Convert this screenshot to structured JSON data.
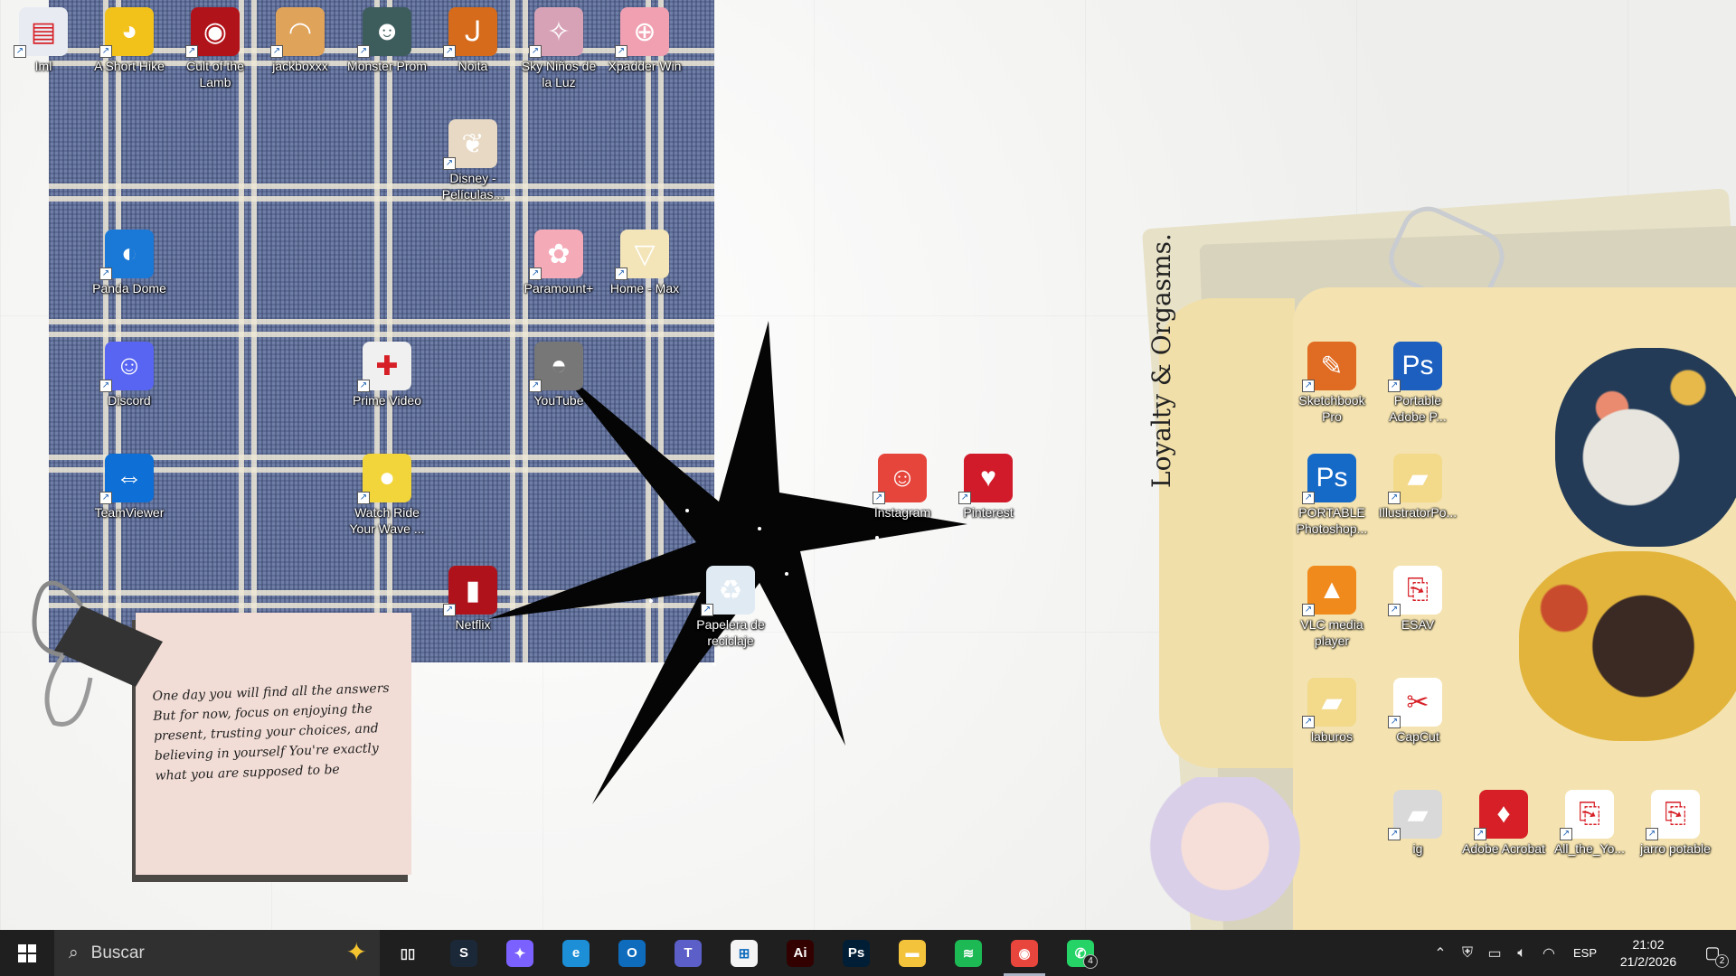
{
  "wallpaper": {
    "folder_title": "Loyalty & Orgasms.",
    "sticky_note": "One day you will find all the answers But for now, focus on enjoying the present, trusting your choices, and believing in yourself You're exactly what you are supposed to be"
  },
  "desktop_icons": [
    {
      "label": "Iml",
      "icon": "app-window-icon",
      "color": "#e8ecf2"
    },
    {
      "label": "A Short Hike",
      "icon": "bird-icon",
      "color": "#f2c21b"
    },
    {
      "label": "Cult of the Lamb",
      "icon": "eye-icon",
      "color": "#b1131a"
    },
    {
      "label": "jackboxxx",
      "icon": "croissant-icon",
      "color": "#e0a35a"
    },
    {
      "label": "Monster Prom",
      "icon": "monster-icon",
      "color": "#3d5c5c"
    },
    {
      "label": "Noita",
      "icon": "noita-icon",
      "color": "#d56b1b"
    },
    {
      "label": "Sky Niños de la Luz",
      "icon": "sky-icon",
      "color": "#d8a2b6"
    },
    {
      "label": "Xpadder Win",
      "icon": "gamepad-icon",
      "color": "#f0a0b0"
    },
    {
      "label": "Disney - Películas...",
      "icon": "cat-figure-icon",
      "color": "#e8d9c4"
    },
    {
      "label": "Panda Dome",
      "icon": "panda-dome-icon",
      "color": "#1a78d6"
    },
    {
      "label": "Paramount+",
      "icon": "paramount-icon",
      "color": "#f5aab8"
    },
    {
      "label": "Home - Max",
      "icon": "tooth-icon",
      "color": "#f3e5b8"
    },
    {
      "label": "Discord",
      "icon": "discord-icon",
      "color": "#5865f2"
    },
    {
      "label": "Prime Video",
      "icon": "pochacco-icon",
      "color": "#f0f0f0"
    },
    {
      "label": "YouTube",
      "icon": "helmet-icon",
      "color": "#777"
    },
    {
      "label": "TeamViewer",
      "icon": "teamviewer-icon",
      "color": "#0e6fd6"
    },
    {
      "label": "Watch Ride Your Wave ...",
      "icon": "yellow-blob-icon",
      "color": "#f2d53a"
    },
    {
      "label": "Netflix",
      "icon": "soda-can-icon",
      "color": "#b0121b"
    },
    {
      "label": "Instagram",
      "icon": "devil-doll-icon",
      "color": "#e6453b"
    },
    {
      "label": "Pinterest",
      "icon": "strawberry-icon",
      "color": "#d11b2a"
    },
    {
      "label": "Papelera de reciclaje",
      "icon": "recycle-bin-icon",
      "color": "#dfeaf3"
    },
    {
      "label": "Sketchbook Pro",
      "icon": "pencil-icon",
      "color": "#e06b22"
    },
    {
      "label": "Portable Adobe P...",
      "icon": "photoshop-icon",
      "color": "#1d5fbf"
    },
    {
      "label": "PORTABLE Photoshop...",
      "icon": "photoshop-icon",
      "color": "#1569c7"
    },
    {
      "label": "IllustratorPo...",
      "icon": "folder-icon",
      "color": "#f3d98a"
    },
    {
      "label": "VLC media player",
      "icon": "vlc-cone-icon",
      "color": "#f08a1c"
    },
    {
      "label": "ESAV",
      "icon": "pdf-file-icon",
      "color": "#ffffff"
    },
    {
      "label": "laburos",
      "icon": "folder-icon",
      "color": "#f3d98a"
    },
    {
      "label": "CapCut",
      "icon": "capcut-icon",
      "color": "#ffffff"
    },
    {
      "label": "ig",
      "icon": "folder-icon",
      "color": "#d9d9d9"
    },
    {
      "label": "Adobe Acrobat",
      "icon": "acrobat-icon",
      "color": "#d61f26"
    },
    {
      "label": "All_the_Yo...",
      "icon": "pdf-file-icon",
      "color": "#ffffff"
    },
    {
      "label": "jarro potable",
      "icon": "pdf-file-icon",
      "color": "#ffffff"
    }
  ],
  "taskbar": {
    "search_placeholder": "Buscar",
    "apps": [
      {
        "name": "task-view",
        "icon": "task-view-icon",
        "text": "▯▯",
        "color": "#1f1f1f"
      },
      {
        "name": "steam",
        "icon": "steam-icon",
        "text": "S",
        "color": "#1b2838"
      },
      {
        "name": "copilot",
        "icon": "copilot-icon",
        "text": "✦",
        "color": "#7b61ff"
      },
      {
        "name": "edge",
        "icon": "edge-icon",
        "text": "e",
        "color": "#1c8fd6"
      },
      {
        "name": "outlook",
        "icon": "outlook-icon",
        "text": "O",
        "color": "#0f6cbd"
      },
      {
        "name": "teams",
        "icon": "teams-icon",
        "text": "T",
        "color": "#5b5fc7"
      },
      {
        "name": "store",
        "icon": "store-icon",
        "text": "⊞",
        "color": "#f4f4f4"
      },
      {
        "name": "illustrator",
        "icon": "illustrator-icon",
        "text": "Ai",
        "color": "#330000"
      },
      {
        "name": "photoshop",
        "icon": "photoshop-icon",
        "text": "Ps",
        "color": "#001e36"
      },
      {
        "name": "file-explorer",
        "icon": "folder-icon",
        "text": "▬",
        "color": "#f3c33b"
      },
      {
        "name": "spotify",
        "icon": "spotify-icon",
        "text": "≋",
        "color": "#1db954"
      },
      {
        "name": "chrome",
        "icon": "chrome-icon",
        "text": "◉",
        "color": "#e8453c"
      },
      {
        "name": "whatsapp",
        "icon": "whatsapp-icon",
        "text": "✆",
        "color": "#25d366",
        "badge": "4"
      }
    ],
    "tray": {
      "language": "ESP",
      "time": "21:02",
      "date": "21/2/2026",
      "notifications": "2"
    }
  }
}
